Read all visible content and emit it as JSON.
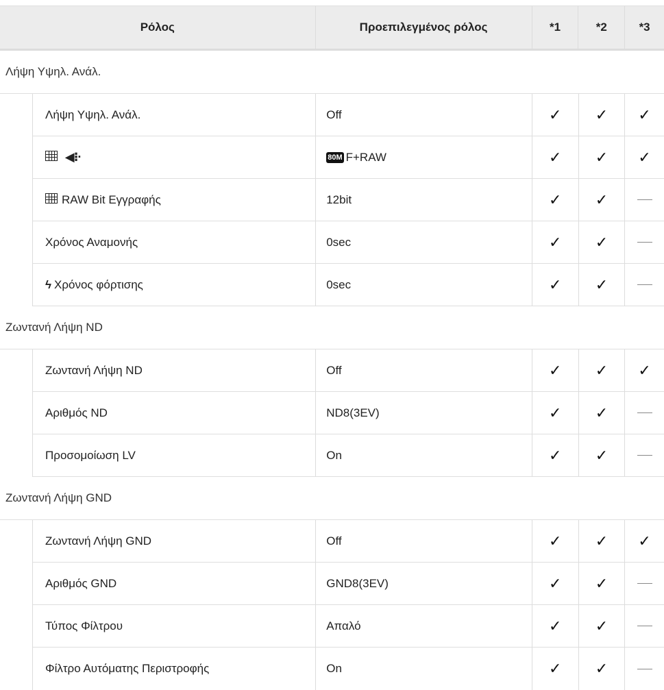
{
  "header": {
    "role": "Ρόλος",
    "default": "Προεπιλεγμένος ρόλος",
    "k1": "*1",
    "k2": "*2",
    "k3": "*3"
  },
  "groups": [
    {
      "label": "Λήψη Υψηλ. Ανάλ.",
      "items": [
        {
          "role": "Λήψη Υψηλ. Ανάλ.",
          "default": "Off",
          "k1": "check",
          "k2": "check",
          "k3": "check"
        },
        {
          "role_icons": [
            "grid-icon",
            "image-quality-icon"
          ],
          "default_badge": "80M",
          "default": "F+RAW",
          "k1": "check",
          "k2": "check",
          "k3": "check"
        },
        {
          "role_icon": "grid-icon",
          "role": "RAW Bit Εγγραφής",
          "default": "12bit",
          "k1": "check",
          "k2": "check",
          "k3": "dash"
        },
        {
          "role": "Χρόνος Αναμονής",
          "default": "0sec",
          "k1": "check",
          "k2": "check",
          "k3": "dash"
        },
        {
          "role_icon": "flash-icon",
          "role": "Χρόνος φόρτισης",
          "default": "0sec",
          "k1": "check",
          "k2": "check",
          "k3": "dash"
        }
      ]
    },
    {
      "label": "Ζωντανή Λήψη ND",
      "items": [
        {
          "role": "Ζωντανή Λήψη ND",
          "default": "Off",
          "k1": "check",
          "k2": "check",
          "k3": "check"
        },
        {
          "role": "Αριθμός ND",
          "default": "ND8(3EV)",
          "k1": "check",
          "k2": "check",
          "k3": "dash"
        },
        {
          "role": "Προσομοίωση LV",
          "default": "On",
          "k1": "check",
          "k2": "check",
          "k3": "dash"
        }
      ]
    },
    {
      "label": "Ζωντανή Λήψη GND",
      "items": [
        {
          "role": "Ζωντανή Λήψη GND",
          "default": "Off",
          "k1": "check",
          "k2": "check",
          "k3": "check"
        },
        {
          "role": "Αριθμός GND",
          "default": "GND8(3EV)",
          "k1": "check",
          "k2": "check",
          "k3": "dash"
        },
        {
          "role": "Τύπος Φίλτρου",
          "default": "Απαλό",
          "k1": "check",
          "k2": "check",
          "k3": "dash"
        },
        {
          "role": "Φίλτρο Αυτόματης Περιστροφής",
          "default": "On",
          "k1": "check",
          "k2": "check",
          "k3": "dash"
        }
      ]
    }
  ],
  "glyphs": {
    "check": "✓",
    "flash": "ϟ",
    "quality": "◀⁝·"
  }
}
